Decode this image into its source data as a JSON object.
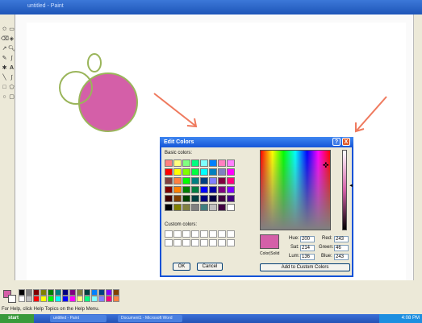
{
  "window": {
    "title": "untitled - Paint"
  },
  "toolbox": {
    "tools": [
      "select-free",
      "select-rect",
      "eraser",
      "fill",
      "color-picker",
      "magnifier",
      "pencil",
      "brush",
      "airbrush",
      "text",
      "line",
      "curve",
      "rectangle",
      "polygon",
      "ellipse",
      "rounded-rect"
    ]
  },
  "colors": {
    "current_foreground": "#d45fa8",
    "current_background": "#ffffff",
    "circle_stroke": "#9ab55a",
    "circle_fill": "#d45fa8"
  },
  "palette": [
    "#000000",
    "#808080",
    "#800000",
    "#808000",
    "#008000",
    "#008080",
    "#000080",
    "#800080",
    "#808040",
    "#004040",
    "#0080ff",
    "#004080",
    "#8000ff",
    "#804000",
    "#ffffff",
    "#c0c0c0",
    "#ff0000",
    "#ffff00",
    "#00ff00",
    "#00ffff",
    "#0000ff",
    "#ff00ff",
    "#ffff80",
    "#00ff80",
    "#80ffff",
    "#8080ff",
    "#ff0080",
    "#ff8040"
  ],
  "statusbar": {
    "text": "For Help, click Help Topics on the Help Menu."
  },
  "taskbar": {
    "start_label": "start",
    "tasks": [
      "untitled - Paint",
      "Document1 - Microsoft Word"
    ],
    "clock": "4:08 PM"
  },
  "dialog": {
    "title": "Edit Colors",
    "help_label": "?",
    "close_label": "X",
    "basic_colors_label": "Basic colors:",
    "custom_colors_label": "Custom colors:",
    "basic_colors": [
      "#ff8080",
      "#ffff80",
      "#80ff80",
      "#00ff80",
      "#80ffff",
      "#0080ff",
      "#ff80c0",
      "#ff80ff",
      "#ff0000",
      "#ffff00",
      "#80ff00",
      "#00ff40",
      "#00ffff",
      "#0080c0",
      "#8080c0",
      "#ff00ff",
      "#804040",
      "#ff8040",
      "#00ff00",
      "#008080",
      "#004080",
      "#8080ff",
      "#800040",
      "#ff0080",
      "#800000",
      "#ff8000",
      "#008000",
      "#008040",
      "#0000ff",
      "#0000a0",
      "#800080",
      "#8000ff",
      "#400000",
      "#804000",
      "#004000",
      "#004040",
      "#000080",
      "#000040",
      "#400040",
      "#400080",
      "#000000",
      "#808000",
      "#808040",
      "#808080",
      "#408080",
      "#c0c0c0",
      "#400040",
      "#ffffff"
    ],
    "ok_label": "OK",
    "cancel_label": "Cancel",
    "color_solid_label": "Color|Solid",
    "hue_label": "Hue:",
    "hue": "200",
    "sat_label": "Sat:",
    "sat": "214",
    "lum_label": "Lum:",
    "lum": "136",
    "red_label": "Red:",
    "red": "243",
    "green_label": "Green:",
    "green": "46",
    "blue_label": "Blue:",
    "blue": "243",
    "add_custom_label": "Add to Custom Colors",
    "crosshair": "✜",
    "lum_arrow": "◄"
  }
}
